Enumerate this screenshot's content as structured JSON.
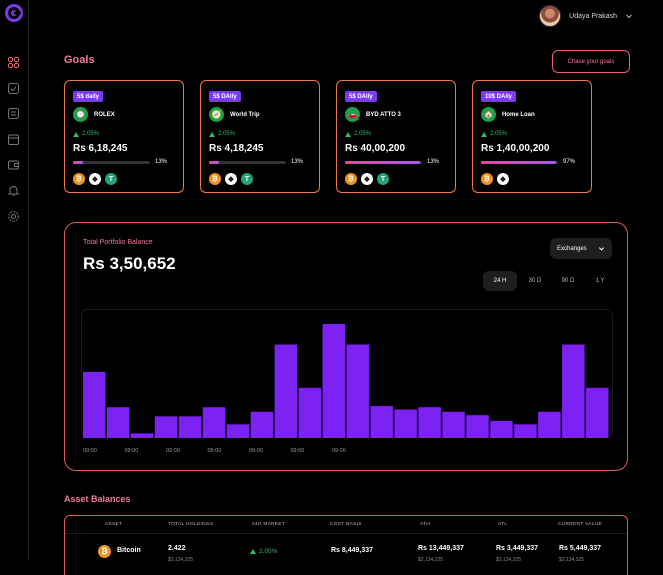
{
  "user": {
    "name": "Udaya Prakash"
  },
  "goals": {
    "title": "Goals",
    "chase_button": "Chase your goals",
    "cards": [
      {
        "badge": "5$ daily",
        "name": "ROLEX",
        "change": "2.05%",
        "amount": "Rs 6,18,245",
        "percent_label": "13%",
        "progress": 0.13,
        "icon": "watch-icon",
        "coins": [
          "bitcoin",
          "ethereum",
          "tether"
        ]
      },
      {
        "badge": "5$ DAily",
        "name": "World Trip",
        "change": "2.05%",
        "amount": "Rs 4,18,245",
        "percent_label": "13%",
        "progress": 0.13,
        "icon": "compass-icon",
        "coins": [
          "bitcoin",
          "ethereum",
          "tether"
        ]
      },
      {
        "badge": "5$ DAily",
        "name": "BYD ATTO 3",
        "change": "2.05%",
        "amount": "Rs 40,00,200",
        "percent_label": "13%",
        "progress": 0.97,
        "icon": "car-icon",
        "coins": [
          "bitcoin",
          "ethereum",
          "tether"
        ]
      },
      {
        "badge": "10$ DAily",
        "name": "Home Loan",
        "change": "2.05%",
        "amount": "Rs 1,40,00,200",
        "percent_label": "97%",
        "progress": 0.97,
        "icon": "house-icon",
        "coins": [
          "bitcoin",
          "ethereum"
        ]
      }
    ]
  },
  "portfolio": {
    "label": "Total Portfolio Balance",
    "value": "Rs 3,50,652",
    "dropdown": "Exchanges",
    "timeframes": [
      "24 H",
      "30 D",
      "90 D",
      "1 Y"
    ],
    "active_timeframe": "24 H"
  },
  "chart_data": {
    "type": "bar",
    "values": [
      58,
      27,
      4,
      19,
      19,
      27,
      12,
      23,
      82,
      44,
      100,
      82,
      28,
      25,
      27,
      23,
      20,
      15,
      12,
      23,
      82,
      44
    ],
    "x_tick_labels": [
      "09:00",
      "09:00",
      "09:00",
      "09:00",
      "09:00",
      "09:00",
      "09:00"
    ],
    "ylim": [
      0,
      100
    ],
    "color": "#7c22f2",
    "grid": false
  },
  "assets": {
    "title": "Asset Balances",
    "columns": [
      "ASSET",
      "TOTAL HOLDINGS",
      "24H MARKET",
      "COST BASIS",
      "ATH",
      "ATL",
      "CURRENT VALUE"
    ],
    "rows": [
      {
        "asset": "Bitcoin",
        "holdings": "2.422",
        "holdings_sub": "$2,134,325",
        "market": "2.05%",
        "cost_basis": "Rs 8,449,337",
        "ath": "Rs 13,449,337",
        "ath_sub": "$2,134,325",
        "atl": "Rs 3,449,337",
        "atl_sub": "$2,134,325",
        "current": "Rs 5,449,337",
        "current_sub": "$2,134,325"
      }
    ]
  },
  "colors": {
    "accent": "#7c3aed",
    "pink": "#f07a9f",
    "border_orange": "#f07b4f",
    "positive": "#22c55e"
  }
}
